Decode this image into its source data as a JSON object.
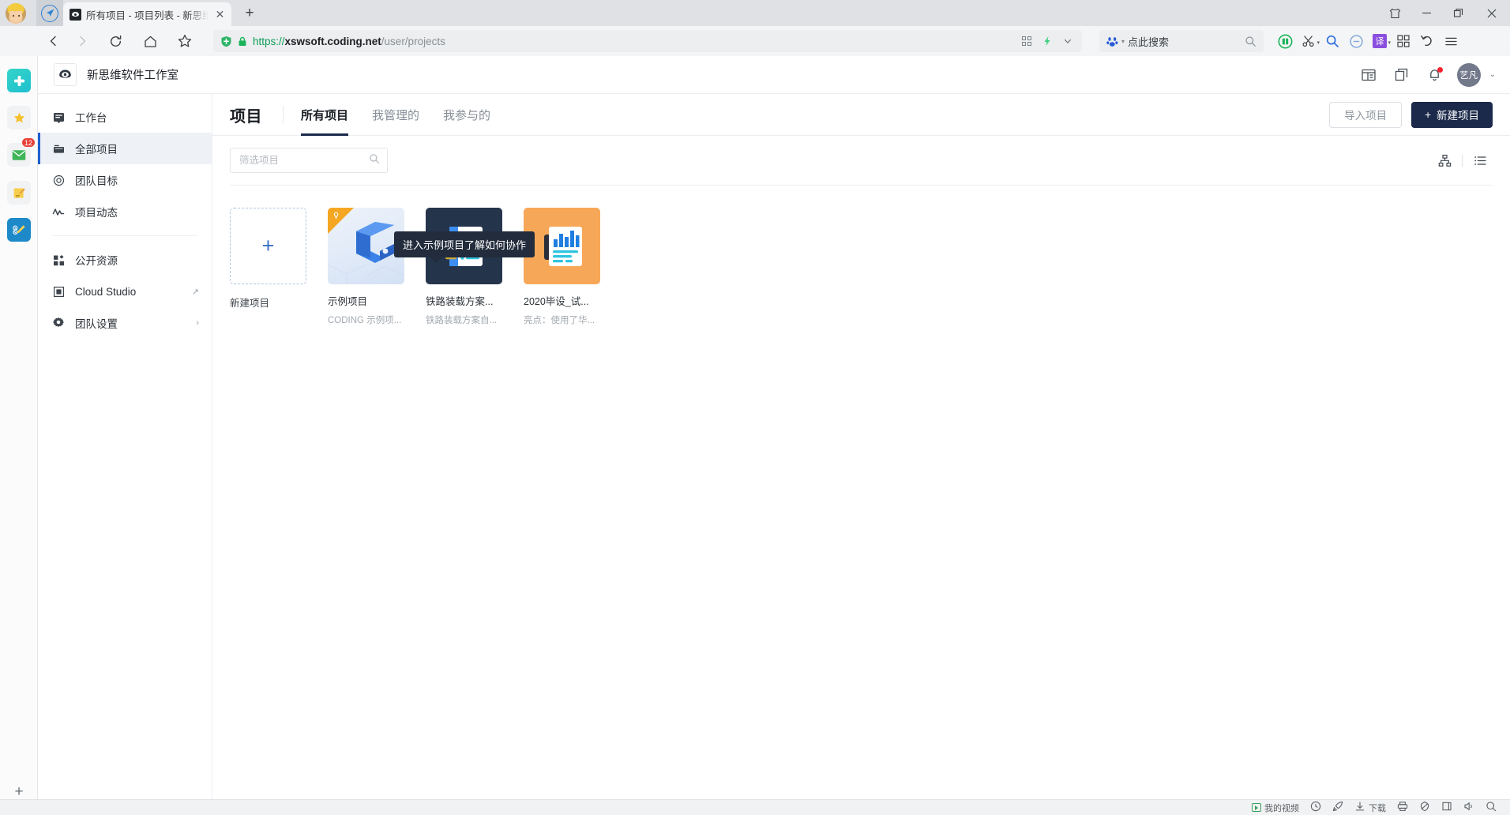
{
  "browser": {
    "tab": {
      "title": "所有项目 - 项目列表 - 新思维软",
      "favicon": "coding-logo-icon",
      "close_label": "✕"
    },
    "newtab_label": "+",
    "window_controls": [
      {
        "name": "skin-icon",
        "label": ""
      },
      {
        "name": "minimize-button",
        "label": ""
      },
      {
        "name": "maximize-button",
        "label": ""
      },
      {
        "name": "close-button",
        "label": ""
      }
    ],
    "omnibox": {
      "scheme": "https://",
      "host": "xswsoft.coding.net",
      "path": "/user/projects",
      "shield_icon": "green-shield-icon",
      "lock_icon": "green-lock-icon",
      "right_icons": [
        "qrcode-icon",
        "lightning-icon",
        "chevron-down-icon"
      ]
    },
    "search": {
      "engine_icon": "baidu-paw-icon",
      "placeholder": "点此搜索"
    },
    "extensions": [
      "green-shield-extension-icon",
      "scissors-icon",
      "magnifier-icon",
      "minus-circle-icon",
      "translate-icon",
      "grid-apps-icon",
      "undo-icon",
      "hamburger-menu-icon"
    ],
    "translate_label": "译",
    "nav": {
      "back_icon": "back-arrow-icon",
      "forward_icon": "forward-arrow-icon",
      "reload_icon": "reload-icon",
      "home_icon": "home-icon",
      "bookmark_icon": "star-icon"
    },
    "rail": [
      {
        "name": "rail-app-icon",
        "icon": "teal-app-icon",
        "badge": ""
      },
      {
        "name": "rail-favorites",
        "icon": "star-icon",
        "badge": ""
      },
      {
        "name": "rail-mail",
        "icon": "mail-icon",
        "badge": "12"
      },
      {
        "name": "rail-notes",
        "icon": "notepad-icon",
        "badge": ""
      },
      {
        "name": "rail-editor",
        "icon": "pencil-icon",
        "badge": ""
      }
    ],
    "rail_add_label": "+",
    "statusbar": [
      {
        "name": "my-videos",
        "icon": "play-icon",
        "label": "我的视频"
      },
      {
        "name": "history",
        "icon": "clock-icon",
        "label": ""
      },
      {
        "name": "speedup",
        "icon": "rocket-icon",
        "label": ""
      },
      {
        "name": "downloads",
        "icon": "download-icon",
        "label": "下载"
      },
      {
        "name": "print",
        "icon": "printer-icon",
        "label": ""
      },
      {
        "name": "privacy",
        "icon": "shield-icon",
        "label": ""
      },
      {
        "name": "window-split",
        "icon": "window-icon",
        "label": ""
      },
      {
        "name": "sound",
        "icon": "speaker-icon",
        "label": ""
      },
      {
        "name": "find",
        "icon": "magnifier-icon",
        "label": ""
      }
    ]
  },
  "app": {
    "header": {
      "team_logo_icon": "coding-mascot-icon",
      "team_name": "新思维软件工作室",
      "icons": [
        {
          "name": "dashboard-icon"
        },
        {
          "name": "copy-window-icon"
        },
        {
          "name": "notification-bell-icon"
        }
      ],
      "avatar_text": "艺凡",
      "caret": "⌄"
    },
    "sidebar": {
      "items": [
        {
          "label": "工作台",
          "icon": "workbench-icon",
          "active": false,
          "after": ""
        },
        {
          "label": "全部项目",
          "icon": "folder-icon",
          "active": true,
          "after": ""
        },
        {
          "label": "团队目标",
          "icon": "target-icon",
          "active": false,
          "after": ""
        },
        {
          "label": "项目动态",
          "icon": "activity-pulse-icon",
          "active": false,
          "after": ""
        },
        {
          "label": "公开资源",
          "icon": "public-resources-icon",
          "active": false,
          "after": ""
        },
        {
          "label": "Cloud Studio",
          "icon": "cloud-studio-icon",
          "active": false,
          "after": "↗"
        },
        {
          "label": "团队设置",
          "icon": "gear-icon",
          "active": false,
          "after": "›"
        }
      ],
      "divider_after_index": 3
    },
    "content": {
      "page_title": "项目",
      "tabs": [
        {
          "label": "所有项目",
          "active": true
        },
        {
          "label": "我管理的",
          "active": false
        },
        {
          "label": "我参与的",
          "active": false
        }
      ],
      "import_button": "导入项目",
      "create_button": "新建项目",
      "create_button_plus": "+",
      "filter_placeholder": "筛选项目",
      "filter_value": "",
      "search_icon": "search-icon",
      "view_toggles": [
        {
          "name": "view-toggle-group",
          "icon": "hierarchy-icon"
        },
        {
          "name": "view-toggle-list",
          "icon": "list-icon"
        }
      ],
      "tooltip": "进入示例项目了解如何协作",
      "new_project_card": {
        "label": "新建项目",
        "plus": "+"
      },
      "projects": [
        {
          "name": "示例项目",
          "desc": "CODING 示例项...",
          "thumb": "demo-c-logo",
          "badge": "bulb-icon"
        },
        {
          "name": "铁路装载方案...",
          "desc": "铁路装载方案自...",
          "thumb": "notebook-dark"
        },
        {
          "name": "2020毕设_试...",
          "desc": "亮点：使用了华...",
          "thumb": "chart-orange"
        }
      ]
    }
  },
  "colors": {
    "accent_blue": "#1f5fd0",
    "primary_navy": "#1b2a4a",
    "tooltip_bg": "#222c3c",
    "orange": "#f7a758",
    "dark_card": "#24344b",
    "badge_red": "#e8413a",
    "green": "#0f9d58"
  }
}
